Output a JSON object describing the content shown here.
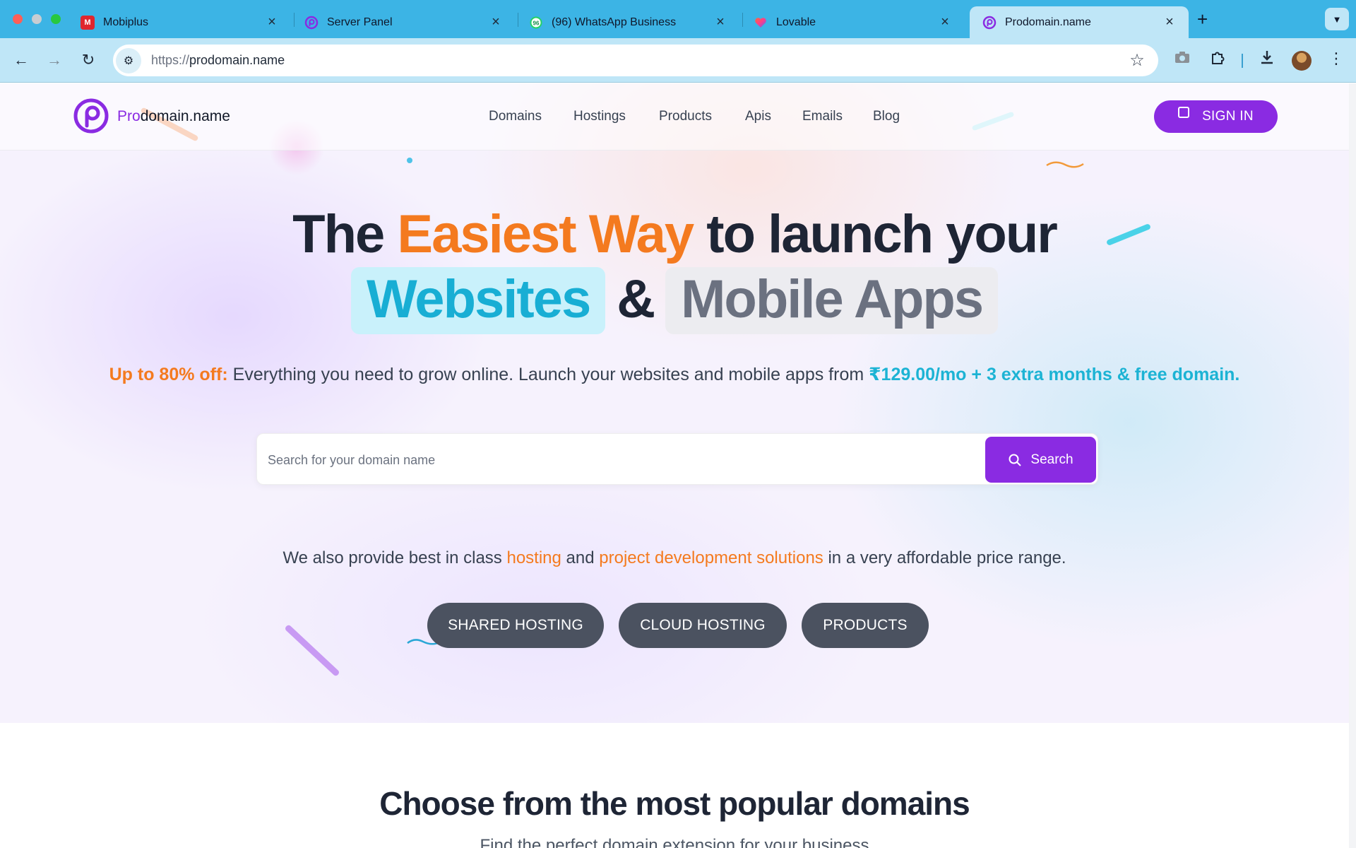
{
  "browser": {
    "tabs": [
      {
        "title": "Mobiplus",
        "icon": "mobiplus-icon"
      },
      {
        "title": "Server Panel",
        "icon": "prodomain-icon"
      },
      {
        "title": "(96) WhatsApp Business",
        "icon": "whatsapp-icon",
        "badge": "96"
      },
      {
        "title": "Lovable",
        "icon": "lovable-heart-icon"
      },
      {
        "title": "Prodomain.name",
        "icon": "prodomain-icon",
        "active": true
      }
    ],
    "url_scheme": "https://",
    "url_host": "prodomain.name"
  },
  "header": {
    "logo_prefix": "Pro",
    "logo_suffix": "domain.name",
    "menu": [
      "Domains",
      "Hostings",
      "Products",
      "Apis",
      "Emails",
      "Blog"
    ],
    "signin_label": "SIGN IN"
  },
  "hero": {
    "line1_a": "The",
    "line1_highlight": "Easiest Way",
    "line1_b": "to launch your",
    "line2_pill1": "Websites",
    "line2_amp": "&",
    "line2_pill2": "Mobile Apps",
    "offer_label": "Up to 80% off:",
    "offer_text": " Everything you need to grow online. Launch your websites and mobile apps from ",
    "offer_price": "₹129.00/mo + 3 extra months & free domain.",
    "search_placeholder": "Search for your domain name",
    "search_button": "Search",
    "provide_a": "We also provide best in class ",
    "provide_hosting": "hosting",
    "provide_b": " and ",
    "provide_solutions": "project development solutions",
    "provide_c": " in a very affordable price range.",
    "categories": [
      "SHARED HOSTING",
      "CLOUD HOSTING",
      "PRODUCTS"
    ]
  },
  "domains_section": {
    "title": "Choose from the most popular domains",
    "subtitle": "Find the perfect domain extension for your business"
  },
  "colors": {
    "brand_purple": "#8a2be2",
    "accent_orange": "#f47a1f",
    "accent_cyan": "#18aed4",
    "chrome_blue": "#3cb4e5"
  }
}
